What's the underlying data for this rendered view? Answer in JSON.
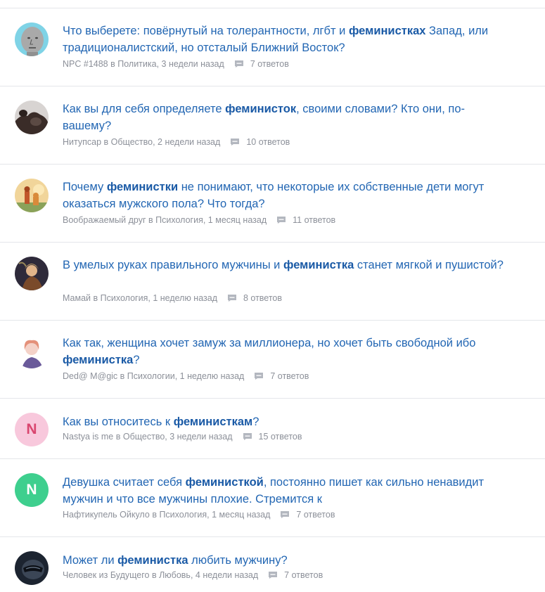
{
  "colors": {
    "link": "#2266b3",
    "highlight": "#1a5aa6",
    "meta": "#8c9099",
    "divider": "#e4e6ea"
  },
  "questions": [
    {
      "title_parts": [
        "Что выберете: повёрнутый на толерантности, лгбт и ",
        "феминистках",
        " Запад, или традиционалистский, но отсталый Ближний Восток?"
      ],
      "author": "NPC #1488",
      "in_word": "в",
      "category": "Политика",
      "time": "3 недели назад",
      "answers": "7 ответов",
      "avatar": "npc-face"
    },
    {
      "title_parts": [
        "Как вы для себя определяете ",
        "феминисток",
        ", своими словами? Кто они, по-вашему?"
      ],
      "author": "Нитупсар",
      "in_word": "в",
      "category": "Общество",
      "time": "2 недели назад",
      "answers": "10 ответов",
      "avatar": "photo-dark"
    },
    {
      "title_parts": [
        "Почему ",
        "феминистки",
        " не понимают, что некоторые их собственные дети могут оказаться мужского пола? Что тогда?"
      ],
      "author": "Воображаемый друг",
      "in_word": "в",
      "category": "Психология",
      "time": "1 месяц назад",
      "answers": "11 ответов",
      "avatar": "photo-sunset"
    },
    {
      "title_parts": [
        "В умелых руках правильного мужчины и ",
        "феминистка",
        " станет мягкой и пушистой?"
      ],
      "author": "Мамай",
      "in_word": "в",
      "category": "Психология",
      "time": "1 неделю назад",
      "answers": "8 ответов",
      "avatar": "photo-painting"
    },
    {
      "title_parts": [
        "Как так, женщина хочет замуж за миллионера, но хочет быть свободной ибо ",
        "феминистка",
        "?"
      ],
      "author": "Ded@ M@gic",
      "in_word": "в",
      "category": "Психологии",
      "time": "1 неделю назад",
      "answers": "7 ответов",
      "avatar": "photo-woman"
    },
    {
      "title_parts": [
        "Как вы относитесь к ",
        "феминисткам",
        "?"
      ],
      "author": "Nastya is me",
      "in_word": "в",
      "category": "Общество",
      "time": "3 недели назад",
      "answers": "15 ответов",
      "avatar": "letter",
      "avatar_letter": "N",
      "avatar_bg": "#f8c8dc",
      "avatar_fg": "#d9466f"
    },
    {
      "title_parts": [
        "Девушка считает себя ",
        "феминисткой",
        ", постоянно пишет как сильно ненавидит мужчин и что все мужчины плохие. Стремится к"
      ],
      "author": "Нафтикупель Ойкуло",
      "in_word": "в",
      "category": "Психология",
      "time": "1 месяц назад",
      "answers": "7 ответов",
      "avatar": "letter",
      "avatar_letter": "N",
      "avatar_bg": "#3ecf8e",
      "avatar_fg": "#ffffff"
    },
    {
      "title_parts": [
        "Может ли ",
        "феминистка",
        " любить мужчину?"
      ],
      "author": "Человек из Будущего",
      "in_word": "в",
      "category": "Любовь",
      "time": "4 недели назад",
      "answers": "7 ответов",
      "avatar": "photo-helmet"
    }
  ]
}
